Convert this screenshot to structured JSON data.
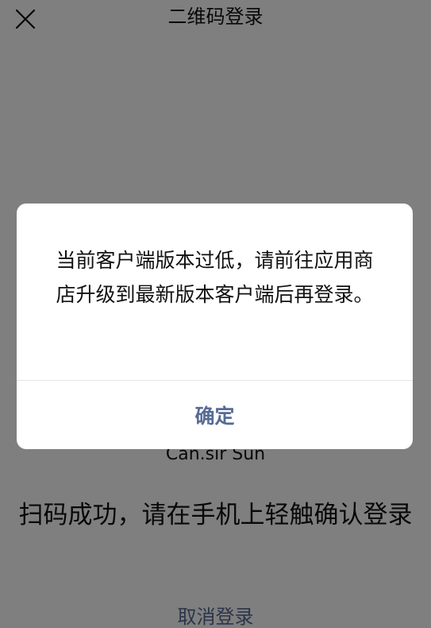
{
  "header": {
    "close_icon": "close-icon",
    "title": "二维码登录"
  },
  "main": {
    "account_name": "Can.sir Sun",
    "status_text": "扫码成功，请在手机上轻触确认登录",
    "cancel_label": "取消登录"
  },
  "dialog": {
    "message": "当前客户端版本过低，请前往应用商店升级到最新版本客户端后再登录。",
    "confirm_label": "确定"
  },
  "colors": {
    "link": "#576b95",
    "text": "#111111",
    "overlay": "rgba(0,0,0,0.5)",
    "background": "#ffffff"
  }
}
